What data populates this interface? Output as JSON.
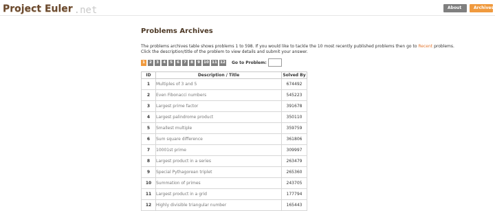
{
  "header": {
    "logo_main": "Project Euler",
    "logo_suffix": ".net",
    "nav": [
      {
        "label": "About"
      },
      {
        "label": "Archives"
      }
    ]
  },
  "main": {
    "title": "Problems Archives",
    "intro_part1": "The problems archives table shows problems 1 to 598. If you would like to tackle the 10 most recently published problems then go to ",
    "intro_link": "Recent",
    "intro_part2": " problems.",
    "intro_line2": "Click the description/title of the problem to view details and submit your answer."
  },
  "pagination": {
    "pages": [
      "1",
      "2",
      "3",
      "4",
      "5",
      "6",
      "7",
      "8",
      "9",
      "10",
      "11",
      "12"
    ],
    "active": "1",
    "goto_label": "Go to Problem:"
  },
  "table": {
    "headers": [
      "ID",
      "Description / Title",
      "Solved By"
    ],
    "rows": [
      {
        "id": "1",
        "title": "Multiples of 3 and 5",
        "solved": "674492"
      },
      {
        "id": "2",
        "title": "Even Fibonacci numbers",
        "solved": "545223"
      },
      {
        "id": "3",
        "title": "Largest prime factor",
        "solved": "391678"
      },
      {
        "id": "4",
        "title": "Largest palindrome product",
        "solved": "350110"
      },
      {
        "id": "5",
        "title": "Smallest multiple",
        "solved": "359759"
      },
      {
        "id": "6",
        "title": "Sum square difference",
        "solved": "361806"
      },
      {
        "id": "7",
        "title": "10001st prime",
        "solved": "309997"
      },
      {
        "id": "8",
        "title": "Largest product in a series",
        "solved": "263479"
      },
      {
        "id": "9",
        "title": "Special Pythagorean triplet",
        "solved": "265360"
      },
      {
        "id": "10",
        "title": "Summation of primes",
        "solved": "243705"
      },
      {
        "id": "11",
        "title": "Largest product in a grid",
        "solved": "177794"
      },
      {
        "id": "12",
        "title": "Highly divisible triangular number",
        "solved": "165443"
      }
    ]
  },
  "colors": {
    "brand_brown": "#6b4a2f",
    "accent_orange": "#f09a3e",
    "nav_gray": "#7f7f7f",
    "link_orange": "#e3762f"
  }
}
